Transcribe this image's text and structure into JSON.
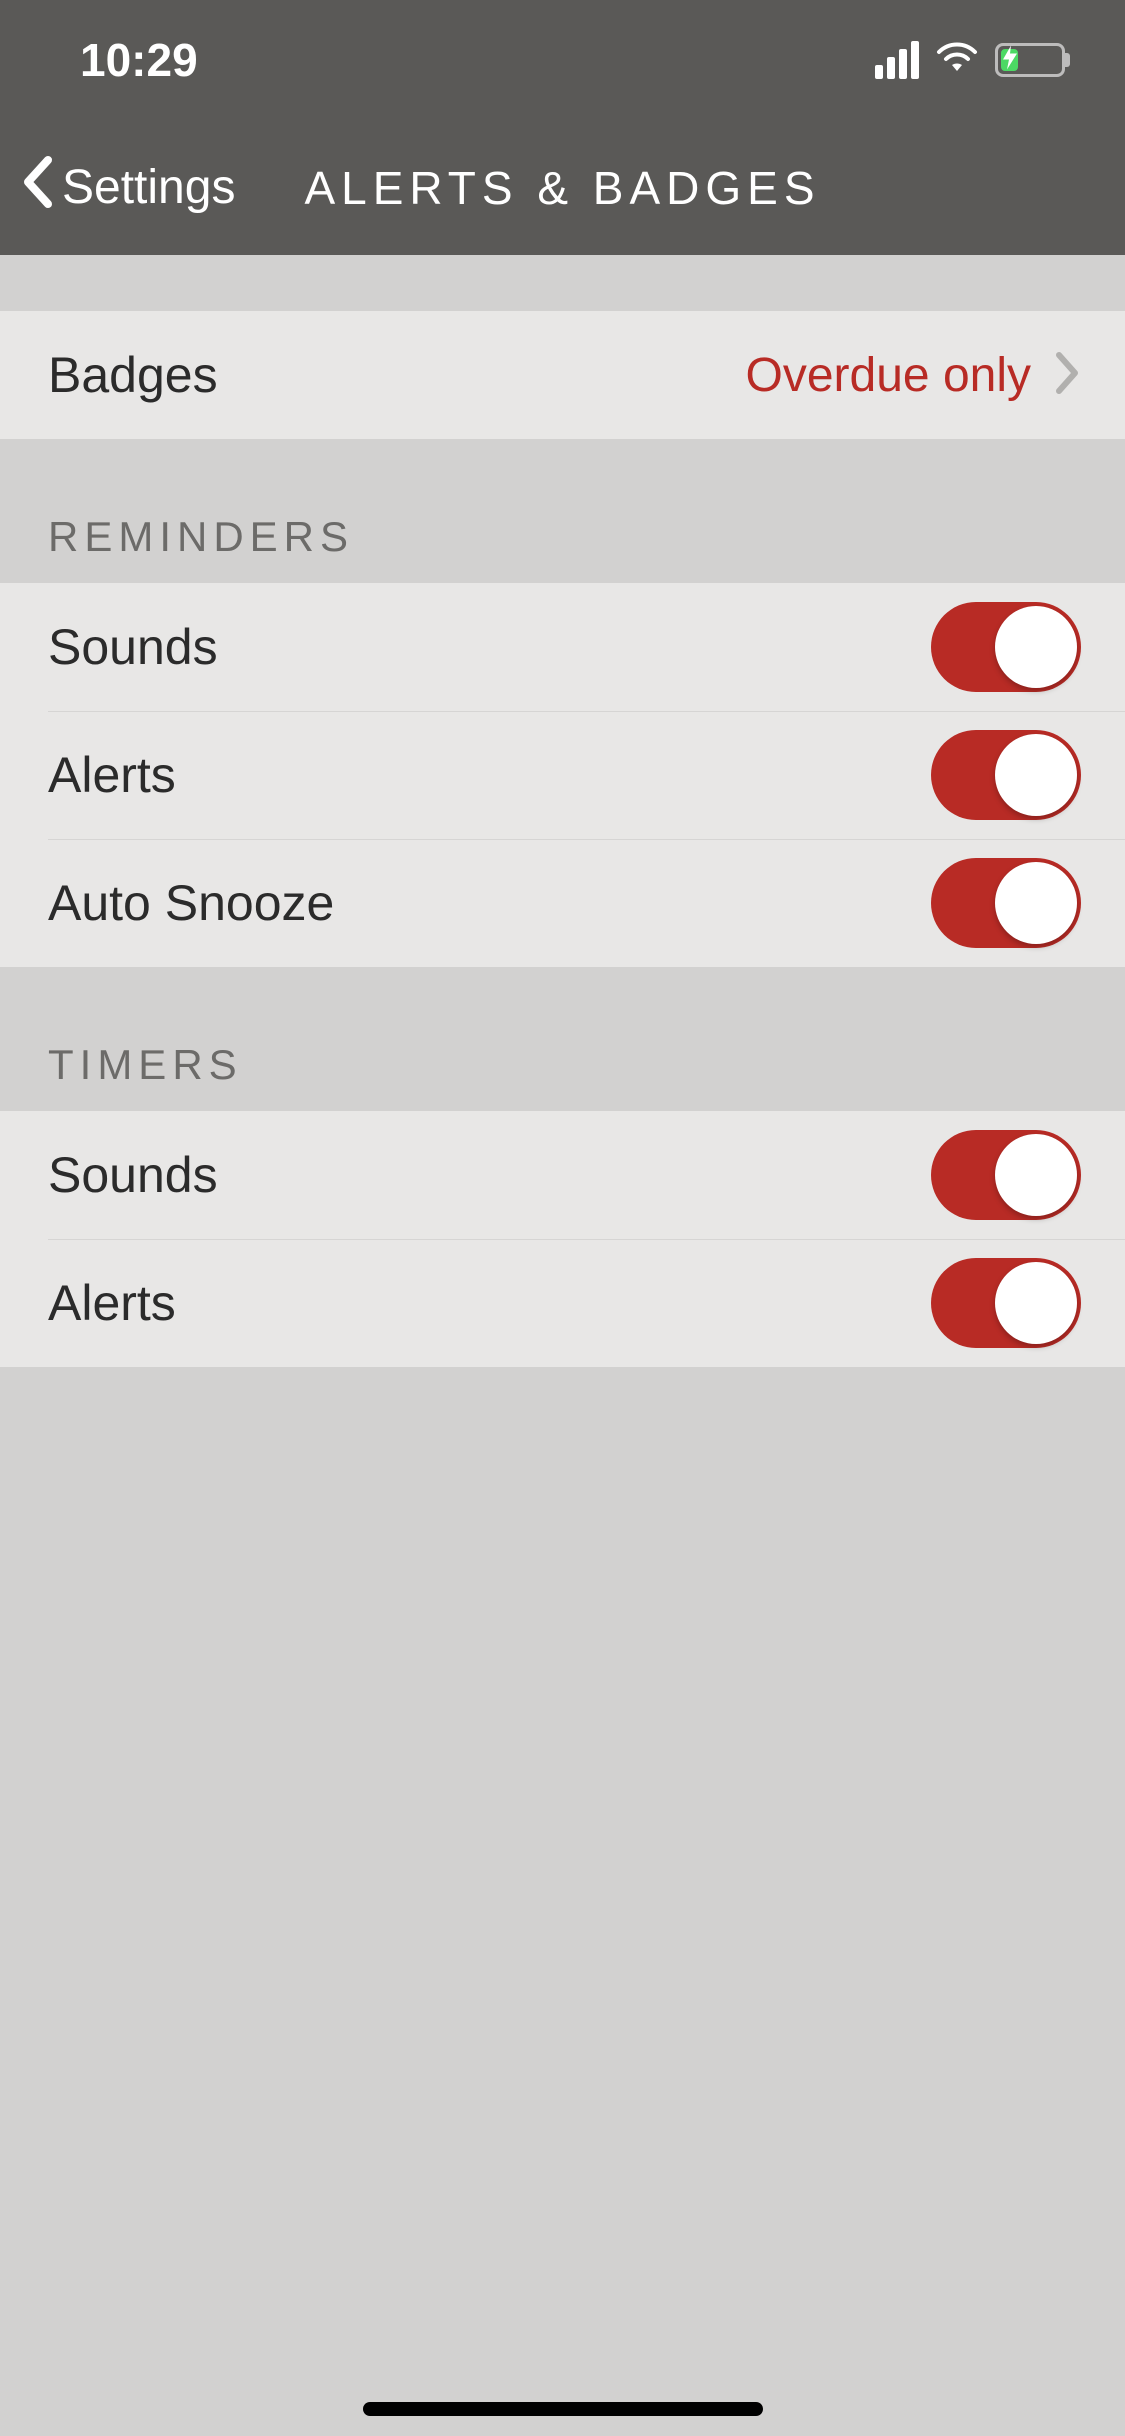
{
  "status": {
    "time": "10:29"
  },
  "nav": {
    "back_label": "Settings",
    "title": "ALERTS & BADGES"
  },
  "badges": {
    "label": "Badges",
    "value": "Overdue only"
  },
  "sections": {
    "reminders": {
      "header": "REMINDERS",
      "sounds_label": "Sounds",
      "sounds_on": true,
      "alerts_label": "Alerts",
      "alerts_on": true,
      "autosnooze_label": "Auto Snooze",
      "autosnooze_on": true
    },
    "timers": {
      "header": "TIMERS",
      "sounds_label": "Sounds",
      "sounds_on": true,
      "alerts_label": "Alerts",
      "alerts_on": true
    }
  }
}
